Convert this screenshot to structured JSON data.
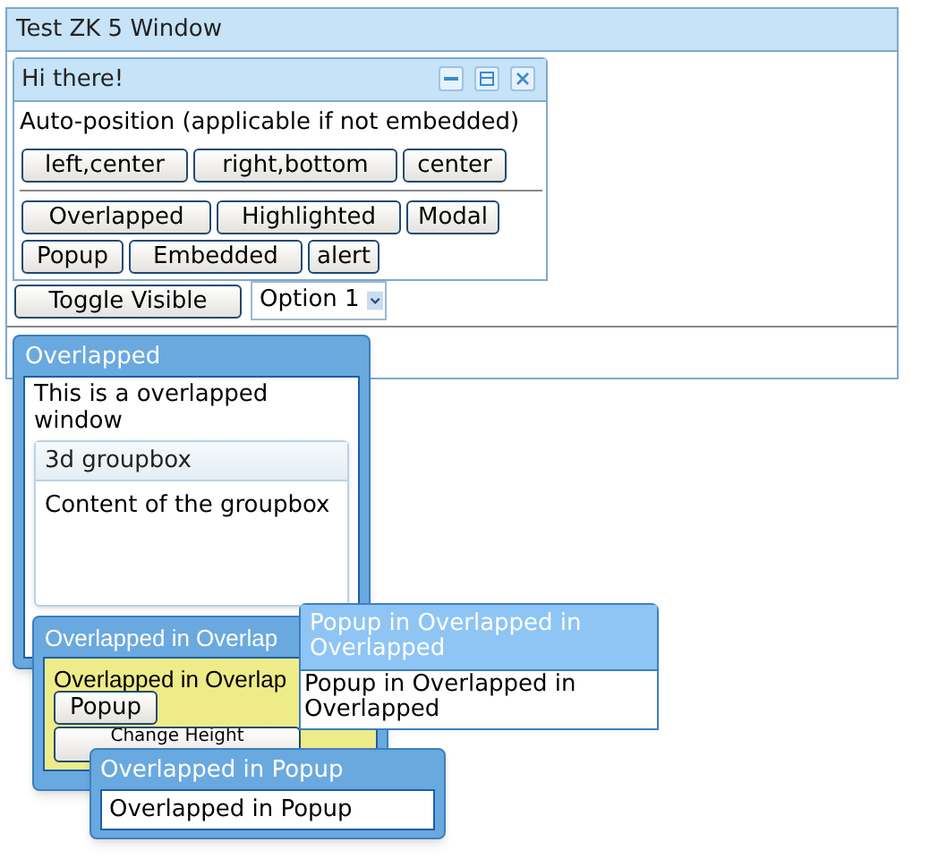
{
  "main_window": {
    "title": "Test ZK 5 Window"
  },
  "hi_window": {
    "title": "Hi there!",
    "text": "Auto-position (applicable if not embedded)",
    "position_buttons": [
      "left,center",
      "right,bottom",
      "center"
    ],
    "mode_buttons": [
      "Overlapped",
      "Highlighted",
      "Modal",
      "Popup",
      "Embedded",
      "alert"
    ]
  },
  "toggle_button": "Toggle Visible",
  "select": {
    "value": "Option 1"
  },
  "overlapped_window": {
    "title": "Overlapped",
    "text": "This is a overlapped window",
    "groupbox": {
      "title": "3d groupbox",
      "content": "Content of the groupbox"
    }
  },
  "overlapped_in_overlapped": {
    "title": "Overlapped in Overlap",
    "text": "Overlapped in Overlap",
    "buttons": [
      "Popup",
      "Change Height"
    ]
  },
  "popup_in_overlapped": {
    "title": "Popup in Overlapped in Overlapped",
    "text": "Popup in Overlapped in Overlapped"
  },
  "overlapped_in_popup": {
    "title": "Overlapped in Popup",
    "text": "Overlapped in Popup"
  }
}
